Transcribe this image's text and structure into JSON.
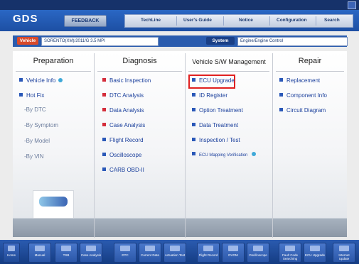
{
  "window": {
    "title_left": "",
    "title_mid": "",
    "title_right": ""
  },
  "logo": "GDS",
  "feedback_label": "FEEDBACK",
  "menu": {
    "items": [
      "TechLine",
      "User's Guide",
      "Notice",
      "Configuration",
      "Search"
    ]
  },
  "vehicle": {
    "label": "Vehicle",
    "value": "SORENTO(XM)/2011/G 3.5 MPI",
    "system_label": "System",
    "system_value": "Engine/Engine Control"
  },
  "sections": {
    "preparation": {
      "title": "Preparation",
      "items": [
        "Vehicle Info",
        "Hot Fix"
      ],
      "subitems": [
        "-By DTC",
        "-By Symptom",
        "-By Model",
        "-By VIN"
      ]
    },
    "diagnosis": {
      "title": "Diagnosis",
      "items": [
        "Basic Inspection",
        "DTC Analysis",
        "Data Analysis",
        "Case Analysis",
        "Flight Record",
        "Oscilloscope",
        "CARB OBD-II"
      ]
    },
    "sw_management": {
      "title": "Vehicle S/W Management",
      "items": [
        "ECU Upgrade",
        "ID Register",
        "Option Treatment",
        "Data Treatment",
        "Inspection / Test",
        "ECU Mapping Verification"
      ]
    },
    "repair": {
      "title": "Repair",
      "items": [
        "Replacement",
        "Component Info",
        "Circuit Diagram"
      ]
    }
  },
  "promo_text": "",
  "bottom_buttons": [
    "Home",
    "Manual",
    "TSB",
    "Case Analysis",
    "DTC",
    "Current Data",
    "Actuation Test",
    "Flight Record",
    "DVOM",
    "Oscilloscope",
    "Fault Code Searching",
    "ECU Upgrade",
    "Internet Update"
  ],
  "colors": {
    "accent": "#1d4fa3",
    "highlight": "#e02020",
    "diag_bullet": "#d42d3b",
    "prep_bullet": "#2a58b8"
  }
}
